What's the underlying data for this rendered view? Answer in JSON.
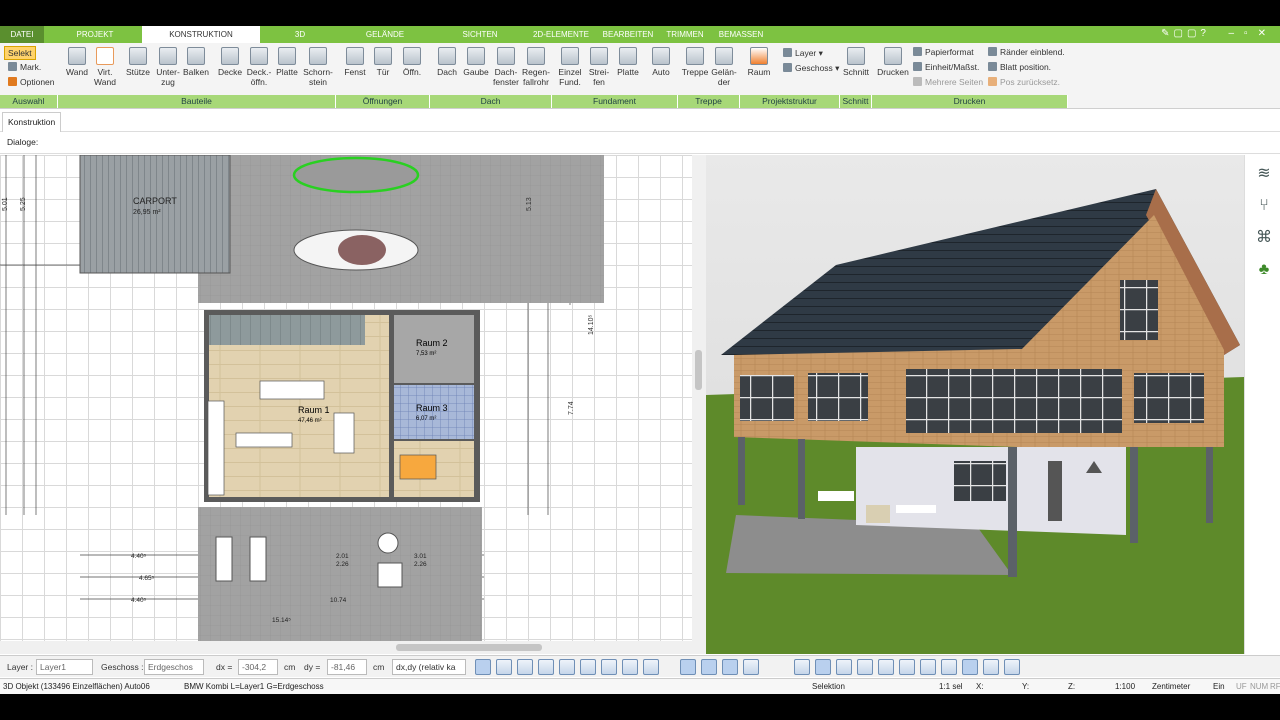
{
  "menu_tabs": [
    "DATEI",
    "PROJEKT",
    "KONSTRUKTION",
    "3D",
    "GELÄNDE",
    "SICHTEN",
    "2D-ELEMENTE",
    "BEARBEITEN",
    "TRIMMEN",
    "BEMASSEN"
  ],
  "ribbon": {
    "auswahl": {
      "select": "Selekt",
      "mark": "Mark.",
      "options": "Optionen"
    },
    "buttons": [
      "Wand",
      "Virt. Wand",
      "Stütze",
      "Unter-zug",
      "Balken",
      "Decke",
      "Deck.-öffn.",
      "Platte",
      "Schorn-stein",
      "Fenst",
      "Tür",
      "Öffn.",
      "Dach",
      "Gaube",
      "Dach-fenster",
      "Regen-fallrohr",
      "Einzel Fund.",
      "Strei-fen",
      "Platte",
      "Auto",
      "Treppe",
      "Gelän-der",
      "Raum",
      "Schnitt",
      "Drucken"
    ],
    "layer": "Layer",
    "geschoss": "Geschoss",
    "print": {
      "papier": "Papierformat",
      "einheit": "Einheit/Maßst.",
      "mehrere": "Mehrere Seiten",
      "raender": "Ränder einblend.",
      "blatt": "Blatt position.",
      "pos": "Pos zurücksetz."
    },
    "groups": [
      "Auswahl",
      "Bauteile",
      "Öffnungen",
      "Dach",
      "Fundament",
      "Treppe",
      "Projektstruktur",
      "Schnitt",
      "Drucken"
    ]
  },
  "subtab": "Konstruktion",
  "dialoge": "Dialoge:",
  "plan": {
    "carport_title": "CARPORT",
    "carport_area": "26,95 m²",
    "raum1": "Raum 1",
    "raum1_area": "47,46 m²",
    "raum2": "Raum 2",
    "raum2_area": "7,53 m²",
    "raum3": "Raum 3",
    "raum3_area": "6,07 m²",
    "dims": [
      "4.40⁵",
      "4.65⁵",
      "4.40⁵",
      "10.74",
      "15.14⁵",
      "2.01",
      "2.26",
      "3.01",
      "2.26",
      "7.74",
      "14.10⁵",
      "5.01",
      "5.25",
      "5.13"
    ]
  },
  "statusbar": {
    "layer_label": "Layer :",
    "layer_value": "Layer1",
    "geschoss_label": "Geschoss :",
    "geschoss_value": "Erdgeschos",
    "dx_label": "dx =",
    "dx_value": "-304,2",
    "dy_label": "dy =",
    "dy_value": "-81,46",
    "unit": "cm",
    "mode": "dx,dy (relativ ka"
  },
  "infobar": {
    "object": "3D Objekt (133496 Einzelflächen) Auto06",
    "car": "BMW Kombi L=Layer1 G=Erdgeschoss",
    "selektion": "Selektion",
    "scale": "1:1 sel",
    "x": "X:",
    "y": "Y:",
    "z": "Z:",
    "ratio": "1:100",
    "unit": "Zentimeter",
    "ein": "Ein",
    "uf": "UF",
    "num": "NUM",
    "rf": "RF"
  },
  "colors": {
    "green": "#7dc241",
    "group_green": "#a7d878",
    "roof": "#2f3a45",
    "brick": "#c99a68",
    "grass": "#5e8a2a"
  }
}
